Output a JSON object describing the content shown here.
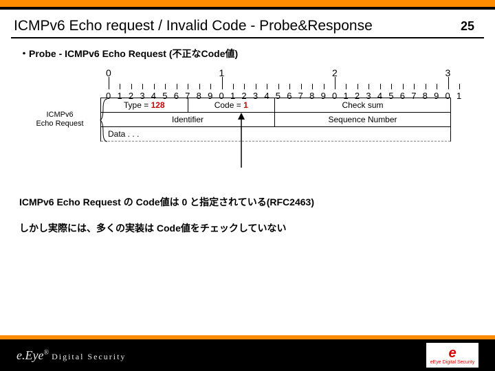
{
  "page_number": "25",
  "title": "ICMPv6 Echo request / Invalid Code - Probe&Response",
  "bullet": "・Probe - ICMPv6 Echo Request (不正なCode値)",
  "side_label_1": "ICMPv6",
  "side_label_2": "Echo Request",
  "ruler": {
    "majors": [
      "0",
      "1",
      "2",
      "3"
    ],
    "minors": [
      "0",
      "1",
      "2",
      "3",
      "4",
      "5",
      "6",
      "7",
      "8",
      "9",
      "0",
      "1",
      "2",
      "3",
      "4",
      "5",
      "6",
      "7",
      "8",
      "9",
      "0",
      "1",
      "2",
      "3",
      "4",
      "5",
      "6",
      "7",
      "8",
      "9",
      "0",
      "1"
    ]
  },
  "row1": {
    "c1_prefix": "Type = ",
    "c1_val": "128",
    "c2_prefix": "Code = ",
    "c2_val": "1",
    "c3": "Check sum"
  },
  "row2": {
    "c1": "Identifier",
    "c2": "Sequence Number"
  },
  "row3": {
    "c1": "Data . . ."
  },
  "note1": "ICMPv6 Echo Request の Code値は 0 と指定されている(RFC2463)",
  "note2": "しかし実際には、多くの実装は Code値をチェックしていない",
  "footer": {
    "brand_left_1": "e.Eye",
    "brand_left_sup": "®",
    "brand_left_2": "Digital Security",
    "brand_right_top": "e",
    "brand_right_bottom": "eEye Digital Security"
  }
}
